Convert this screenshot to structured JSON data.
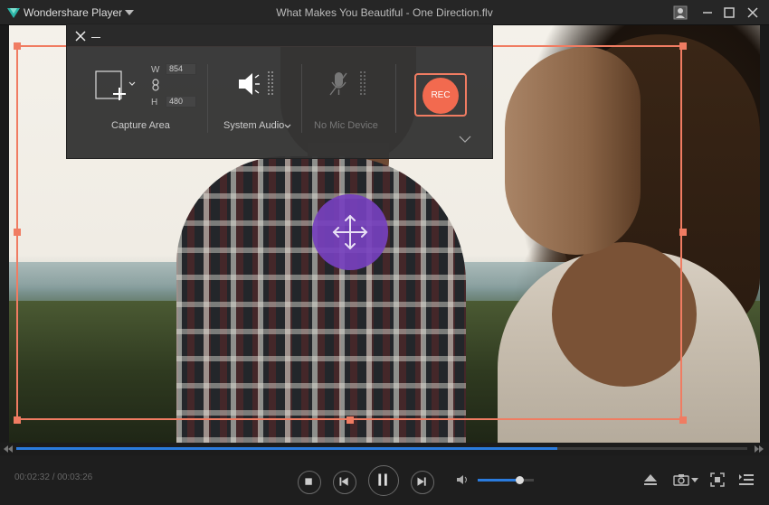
{
  "app": {
    "name": "Wondershare Player",
    "window_title": "What Makes You Beautiful - One Direction.flv"
  },
  "recorder": {
    "capture_area_label": "Capture Area",
    "width_label": "W",
    "height_label": "H",
    "width_value": "854",
    "height_value": "480",
    "audio_label": "System Audio",
    "mic_label": "No Mic Device",
    "rec_label": "REC"
  },
  "player": {
    "time_display": "00:02:32 / 00:03:26",
    "progress_fraction": 0.74,
    "volume_fraction": 0.74
  },
  "colors": {
    "accent": "#f07c62",
    "rec": "#f26a4f",
    "move_handle": "#7640be",
    "progress": "#2a7bdd"
  },
  "icons": {
    "logo": "wondershare-logo-icon",
    "user": "user-icon",
    "minimize": "minimize-icon",
    "maximize": "maximize-icon",
    "close": "close-icon",
    "capture": "capture-area-icon",
    "link": "link-icon",
    "speaker": "speaker-icon",
    "mic": "microphone-icon",
    "move": "move-icon",
    "stop": "stop-icon",
    "previous": "previous-icon",
    "pause": "pause-icon",
    "next": "next-icon",
    "volume": "volume-icon",
    "eject": "eject-icon",
    "camera": "camera-icon",
    "fullscreen": "fullscreen-icon",
    "playlist": "playlist-icon"
  }
}
